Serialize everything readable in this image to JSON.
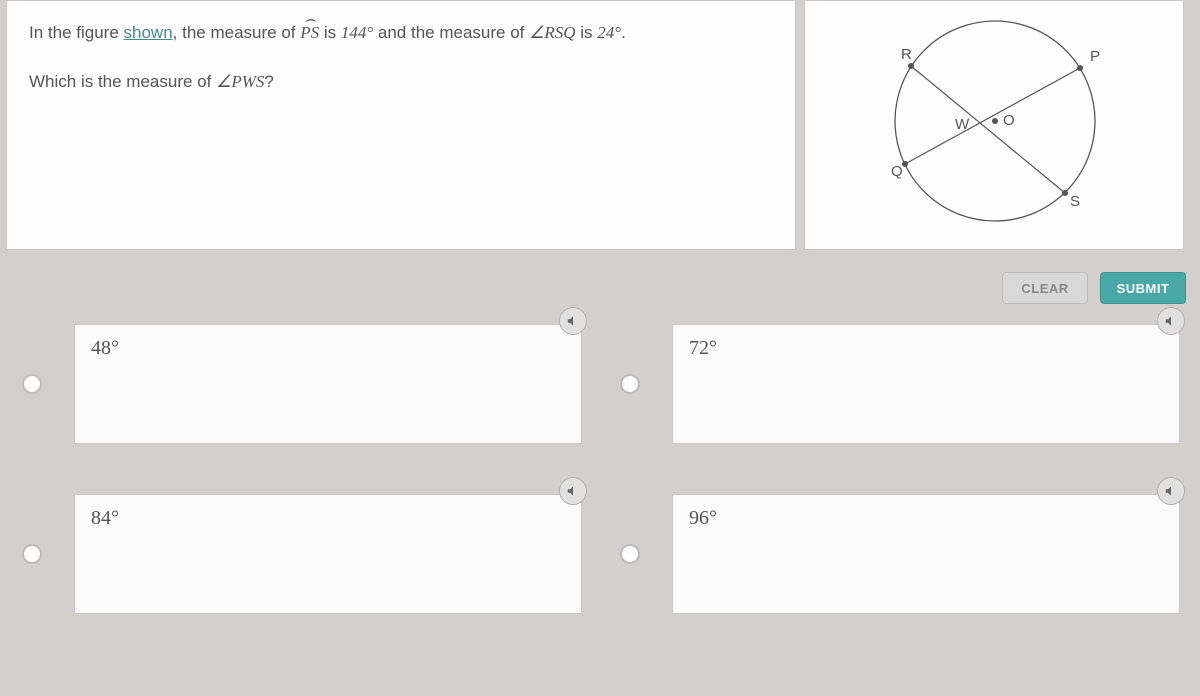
{
  "question": {
    "line1_prefix": "In the figure ",
    "shown_word": "shown",
    "line1_mid": ", the measure of ",
    "arc_label": "PS",
    "line1_is": " is ",
    "arc_value": "144°",
    "line1_and": " and the measure of ",
    "angle1": "∠RSQ",
    "line1_is2": " is ",
    "angle1_value": "24°",
    "line1_end": ".",
    "line2_prefix": "Which is the measure of ",
    "angle2": "∠PWS",
    "line2_end": "?"
  },
  "figure": {
    "labels": {
      "P": "P",
      "R": "R",
      "Q": "Q",
      "S": "S",
      "W": "W",
      "O": "O"
    }
  },
  "buttons": {
    "clear": "CLEAR",
    "submit": "SUBMIT"
  },
  "options": [
    {
      "label": "48°"
    },
    {
      "label": "72°"
    },
    {
      "label": "84°"
    },
    {
      "label": "96°"
    }
  ]
}
